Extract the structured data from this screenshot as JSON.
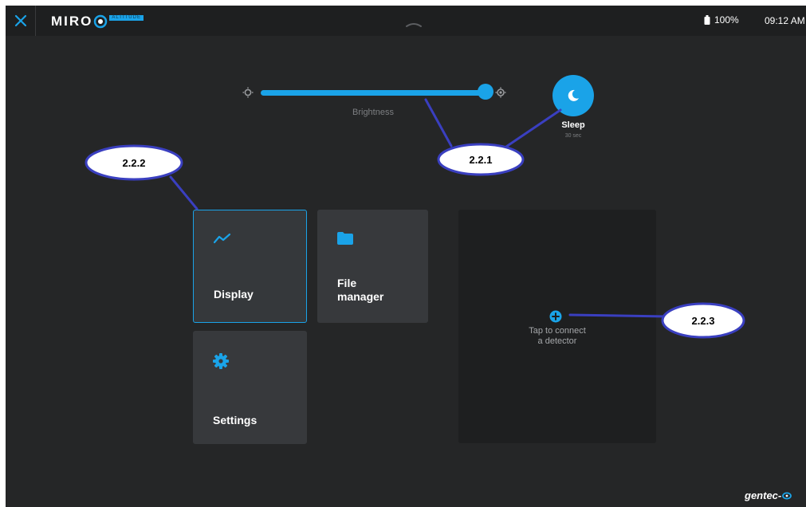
{
  "app": {
    "logo_text": "MIRO",
    "logo_subtitle": "ALTITUDE",
    "battery_percent": "100%",
    "time": "09:12 AM"
  },
  "icons": {
    "close": "close-icon",
    "pull_handle": "chevron-up-icon",
    "battery": "battery-icon",
    "brightness_low": "sun-low-icon",
    "brightness_high": "sun-high-icon",
    "sleep": "moon-icon",
    "display": "trend-line-icon",
    "file_manager": "folder-icon",
    "settings": "gear-icon",
    "add_detector": "plus-circle-icon"
  },
  "brightness": {
    "label": "Brightness",
    "level": 1.0
  },
  "sleep": {
    "label": "Sleep",
    "timeout": "30 sec"
  },
  "tiles": {
    "display": "Display",
    "file_manager_line1": "File",
    "file_manager_line2": "manager",
    "settings": "Settings"
  },
  "detector": {
    "line1": "Tap to connect",
    "line2": "a detector"
  },
  "brand": "gentec-",
  "annotations": {
    "a": "2.2.1",
    "b": "2.2.2",
    "c": "2.2.3"
  },
  "colors": {
    "accent": "#1aa3e8",
    "background": "#252627",
    "tile": "#37393c",
    "callout_border": "#3a3fc0"
  }
}
